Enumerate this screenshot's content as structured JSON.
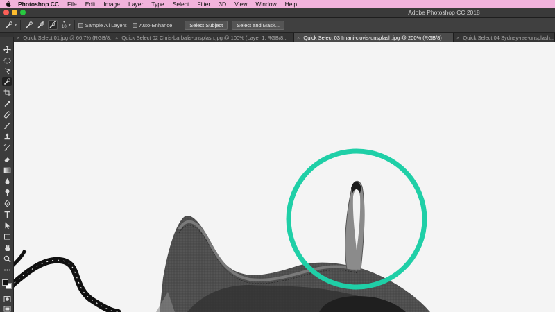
{
  "menubar": {
    "app_name": "Photoshop CC",
    "items": [
      "File",
      "Edit",
      "Image",
      "Layer",
      "Type",
      "Select",
      "Filter",
      "3D",
      "View",
      "Window",
      "Help"
    ]
  },
  "window": {
    "title": "Adobe Photoshop CC 2018"
  },
  "options_bar": {
    "brush_size": "10",
    "sample_all_layers_label": "Sample All Layers",
    "auto_enhance_label": "Auto-Enhance",
    "select_subject_label": "Select Subject",
    "select_and_mask_label": "Select and Mask..."
  },
  "tabs": [
    {
      "label": "Quick Select 01.jpg @ 66.7% (RGB/8...",
      "active": false
    },
    {
      "label": "Quick Select 02 Chris-barbalis-unsplash.jpg @ 100% (Layer 1, RGB/8...",
      "active": false
    },
    {
      "label": "Quick Select 03 Imani-clovis-unsplash.jpg @ 200% (RGB/8)",
      "active": true
    },
    {
      "label": "Quick Select 04 Sydney-rae-unsplash...",
      "active": false
    }
  ],
  "colors": {
    "menubar": "#f2b3dc",
    "highlight_circle": "#1fcfa7",
    "canvas_bg": "#f4f4f4"
  },
  "toolbar": {
    "tools": [
      "move-icon",
      "marquee-icon",
      "lasso-icon",
      "quick-selection-icon",
      "crop-icon",
      "eyedropper-icon",
      "healing-icon",
      "brush-icon",
      "stamp-icon",
      "history-brush-icon",
      "eraser-icon",
      "gradient-icon",
      "blur-icon",
      "dodge-icon",
      "pen-icon",
      "type-icon",
      "path-select-icon",
      "shape-icon",
      "hand-icon",
      "zoom-icon",
      "more-icon"
    ]
  }
}
